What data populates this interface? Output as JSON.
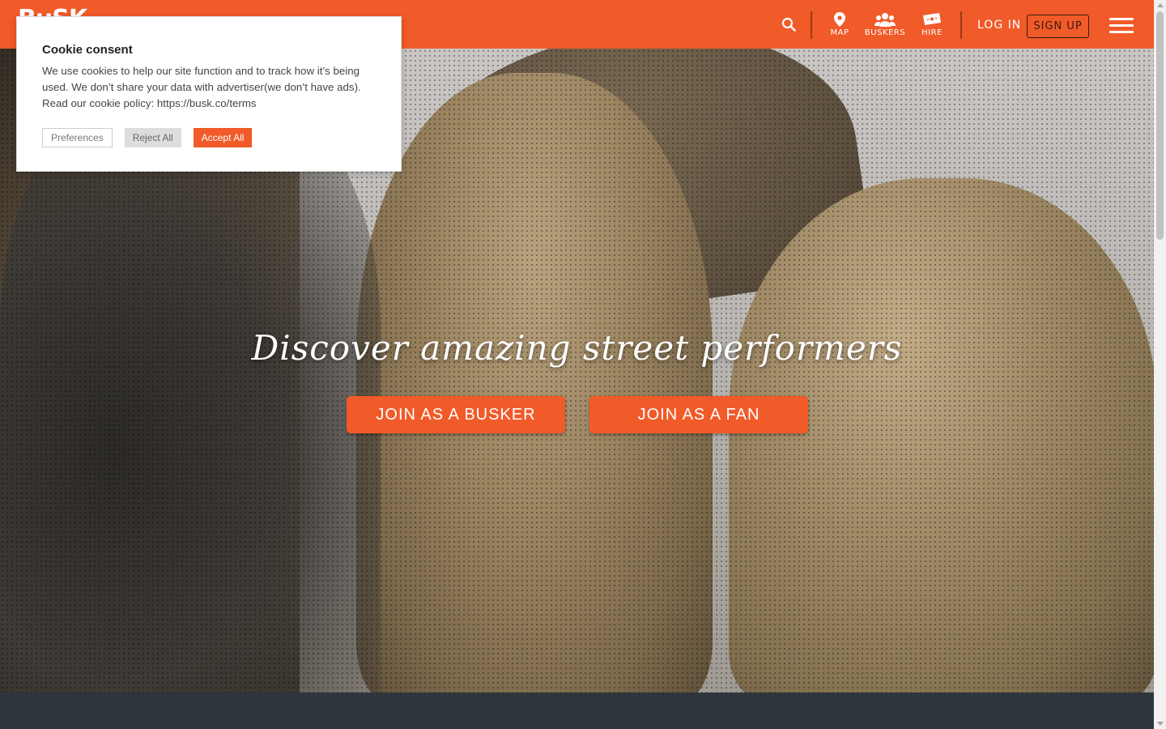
{
  "header": {
    "logo_text": "BuSK",
    "map_label": "MAP",
    "buskers_label": "BUSKERS",
    "hire_label": "HIRE",
    "login_label": "LOG IN",
    "signup_label": "SIGN UP"
  },
  "hero": {
    "title": "Discover amazing street performers",
    "join_busker_label": "JOIN AS A BUSKER",
    "join_fan_label": "JOIN AS A FAN"
  },
  "cookie": {
    "title": "Cookie consent",
    "text": "We use cookies to help our site function and to track how it’s being used. We don’t share your data with advertiser(we don’t have ads). Read our cookie policy: https://busk.co/terms",
    "preferences_label": "Preferences",
    "reject_label": "Reject All",
    "accept_label": "Accept All"
  },
  "colors": {
    "brand": "#f15a29",
    "footer_band": "#2f353d"
  }
}
